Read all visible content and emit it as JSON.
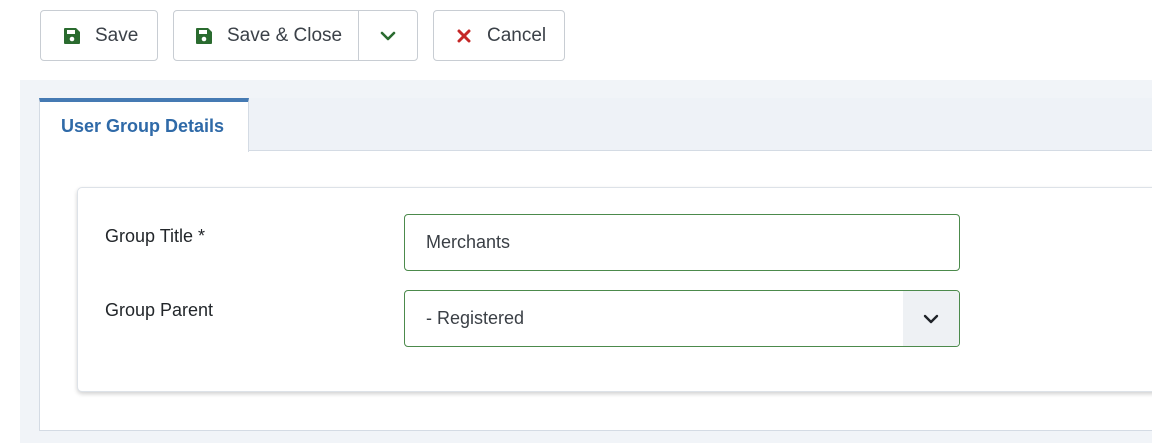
{
  "toolbar": {
    "save_label": "Save",
    "save_close_label": "Save & Close",
    "cancel_label": "Cancel",
    "save_icon": "floppy-disk-icon",
    "dropdown_icon": "chevron-down-icon",
    "cancel_icon": "x-icon"
  },
  "tabs": [
    {
      "label": "User Group Details",
      "active": true
    }
  ],
  "form": {
    "group_title": {
      "label": "Group Title *",
      "value": "Merchants"
    },
    "group_parent": {
      "label": "Group Parent",
      "value": "- Registered"
    }
  },
  "colors": {
    "save_icon": "#2a6b2f",
    "cancel_icon": "#c52827",
    "tab_accent": "#457ab3",
    "field_border_valid": "#4c8a4c"
  }
}
